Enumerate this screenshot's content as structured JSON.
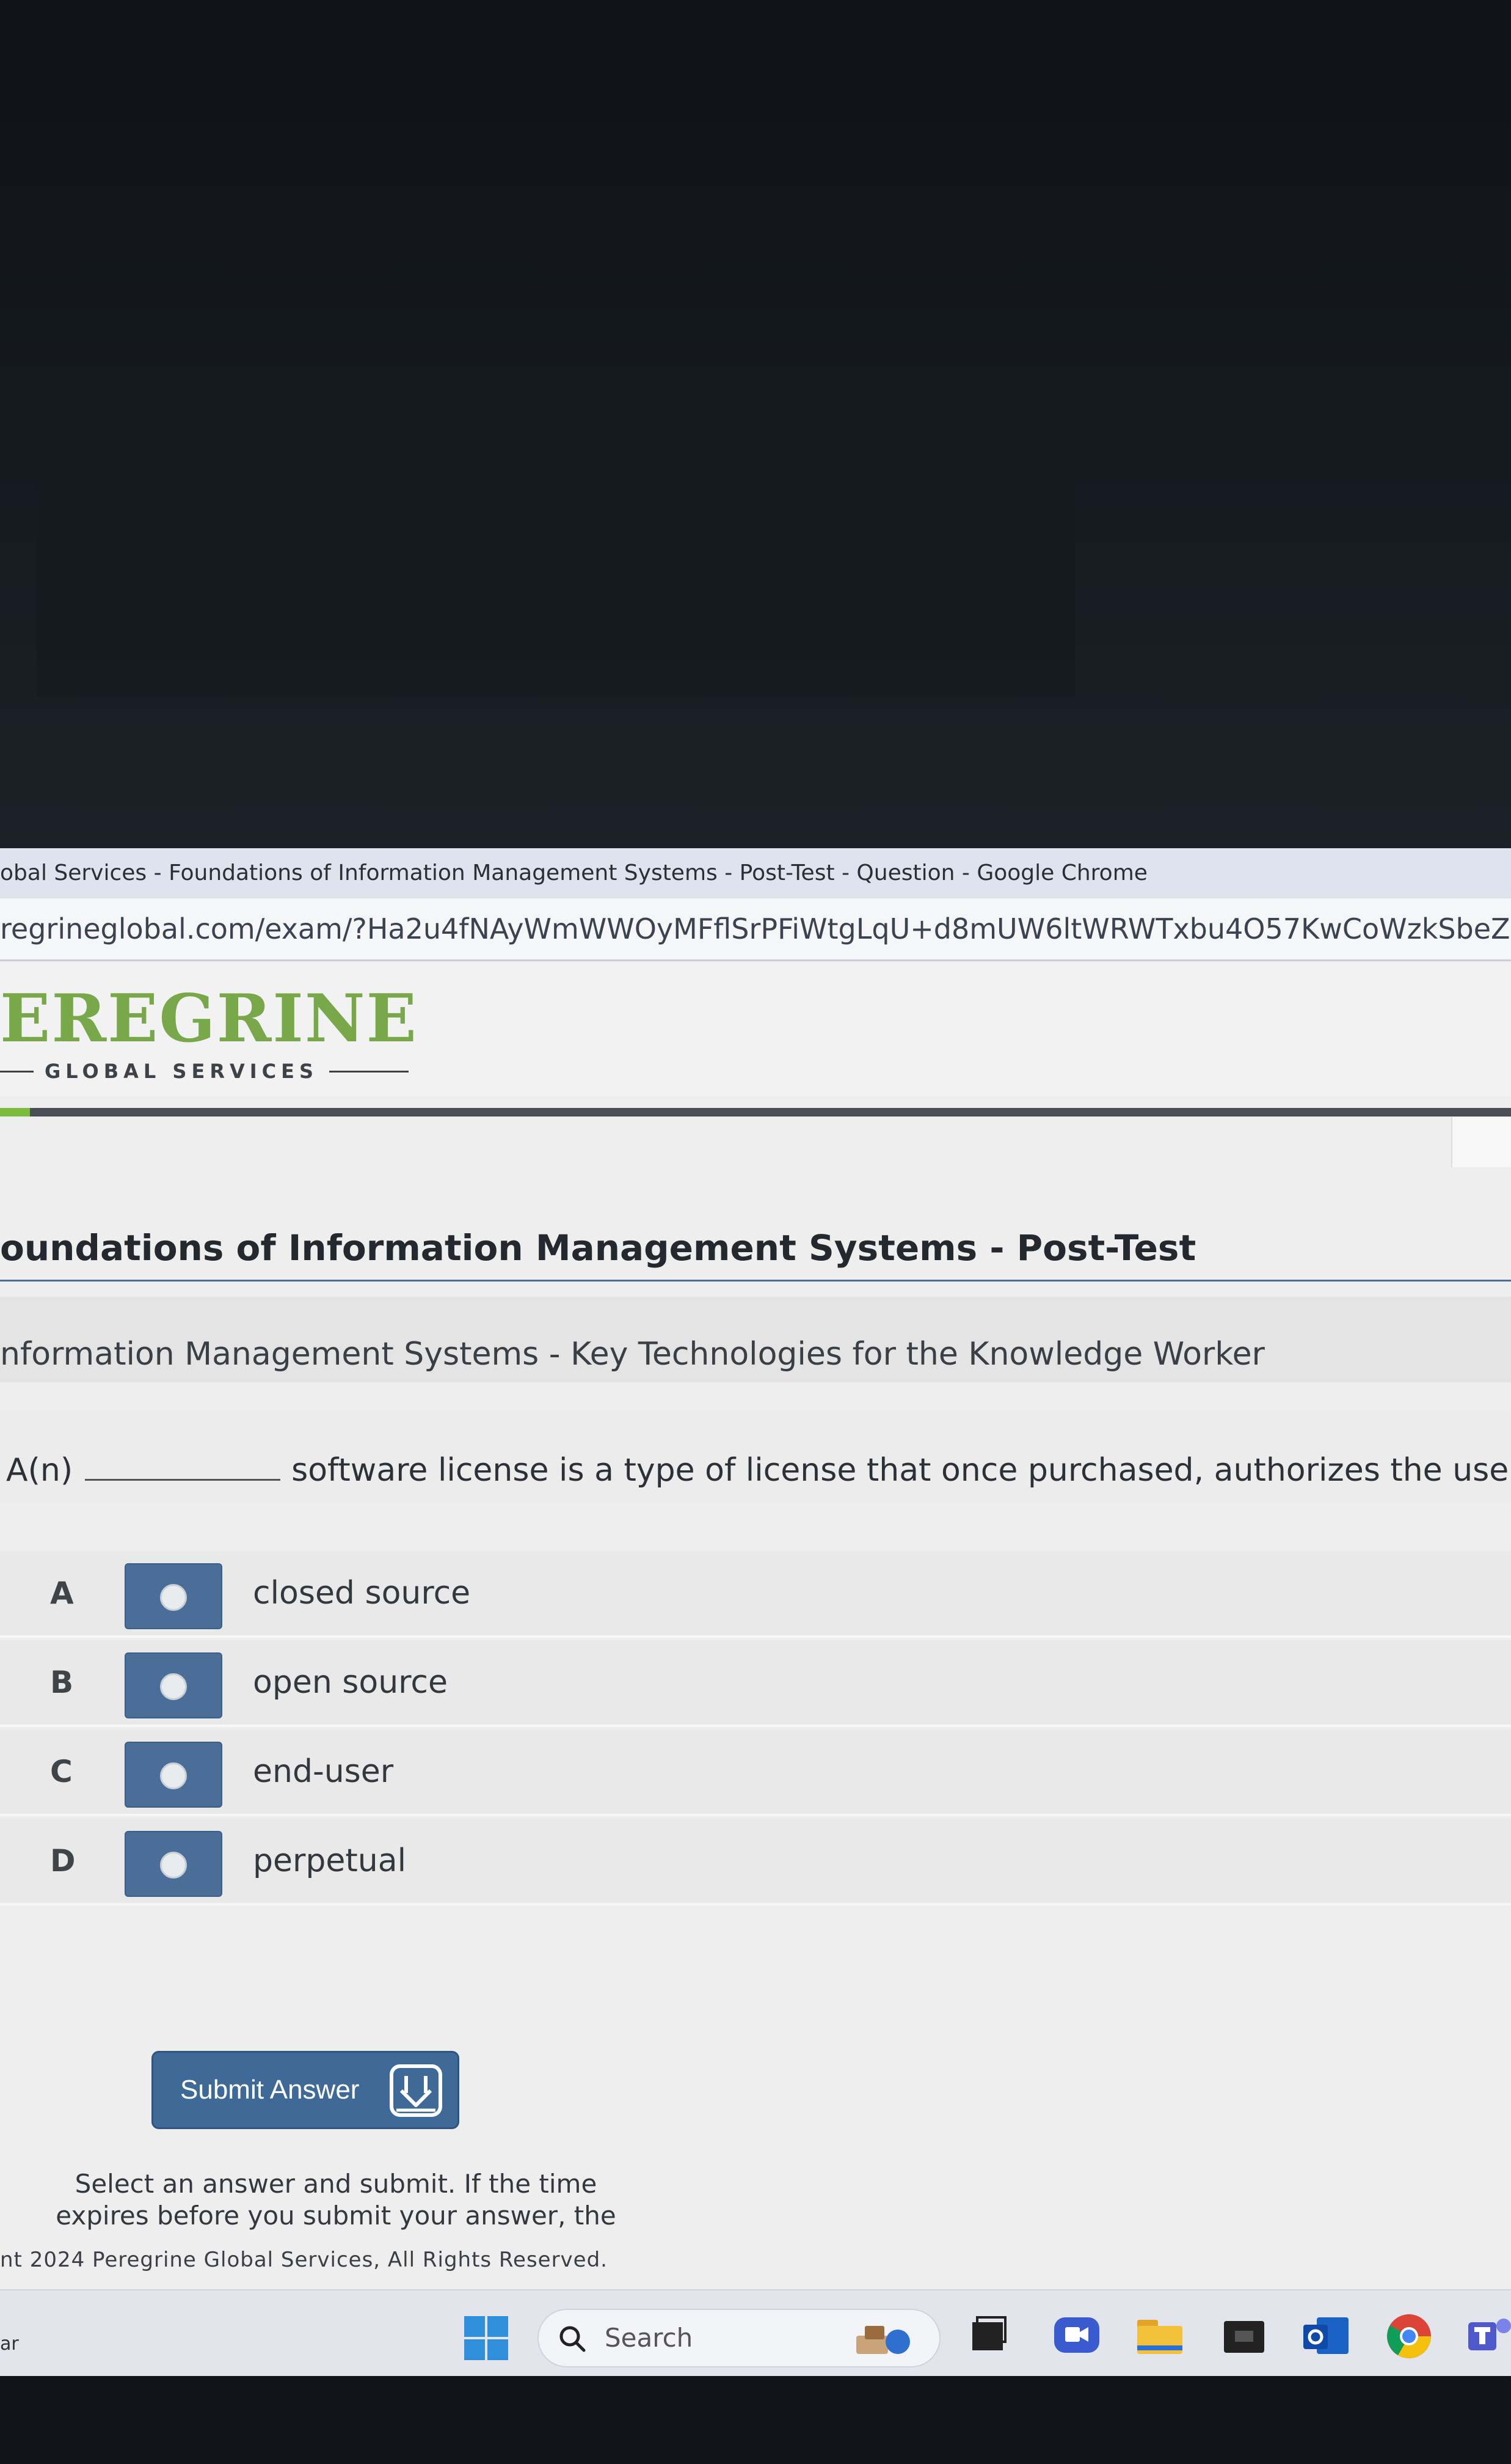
{
  "window": {
    "title": "obal Services - Foundations of Information Management Systems - Post-Test - Question - Google Chrome",
    "url": "regrineglobal.com/exam/?Ha2u4fNAyWmWWOyMFflSrPFiWtgLqU+d8mUW6ltWRWTxbu4O57KwCoWzkSbeZeDbrWipaTNCu"
  },
  "header": {
    "logo_main": "EREGRINE",
    "logo_sub": "GLOBAL SERVICES",
    "brand_color": "#78a84a"
  },
  "exam": {
    "title": "oundations of Information Management Systems - Post-Test",
    "topic": "nformation Management Systems - Key Technologies for the Knowledge Worker",
    "progress_fraction": 0.02
  },
  "question": {
    "prefix": "A(n)",
    "text": "software license is a type of license that once purchased, authorizes the use th"
  },
  "answers": [
    {
      "letter": "A",
      "text": "closed source",
      "selected": false
    },
    {
      "letter": "B",
      "text": "open source",
      "selected": false
    },
    {
      "letter": "C",
      "text": "end-user",
      "selected": false
    },
    {
      "letter": "D",
      "text": "perpetual",
      "selected": false
    }
  ],
  "submit": {
    "label": "Submit Answer",
    "icon": "download-tray-icon",
    "color": "#3f6a97"
  },
  "instructions": {
    "line1": "Select an answer and submit. If the time",
    "line2": "expires before you submit your answer, the"
  },
  "footer": {
    "copyright": "nt 2024 Peregrine Global Services, All Rights Reserved."
  },
  "taskbar": {
    "left_text": "ar",
    "search_placeholder": "Search",
    "icons": [
      "windows-start-icon",
      "search-icon",
      "task-view-icon",
      "meet-icon",
      "file-explorer-icon",
      "store-icon",
      "outlook-icon",
      "chrome-icon",
      "teams-icon"
    ]
  }
}
